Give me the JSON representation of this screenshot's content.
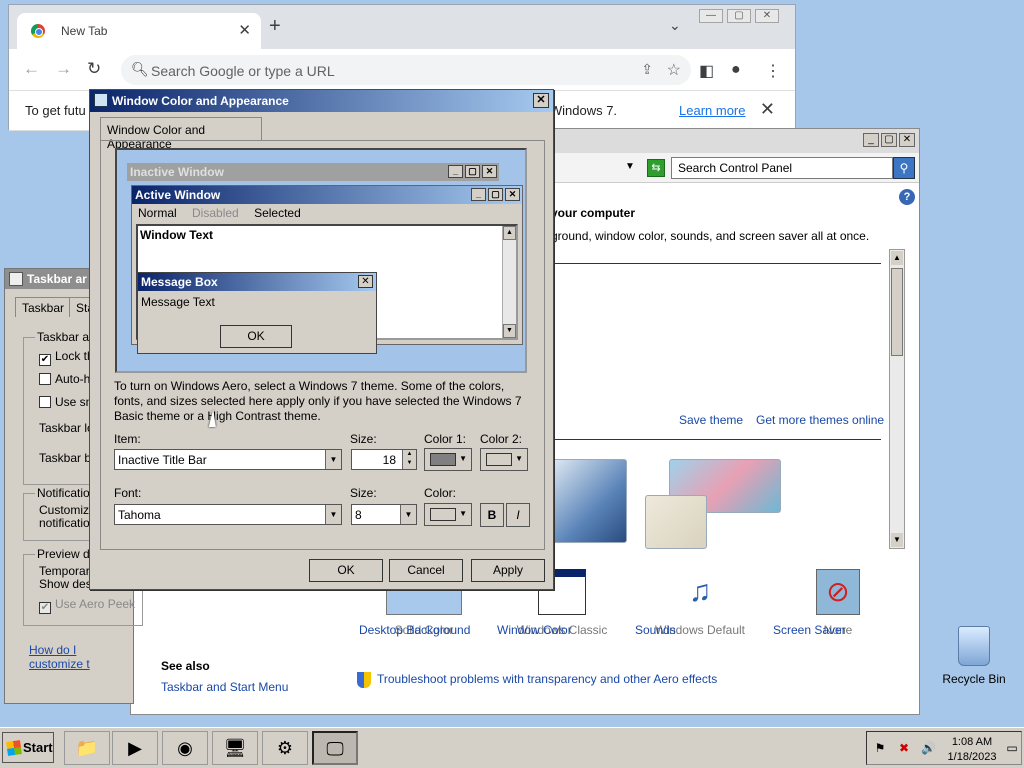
{
  "browser": {
    "tab_title": "New Tab",
    "omnibox_placeholder": "Search Google or type a URL",
    "infobar_message_start": "To get futu",
    "infobar_message_end": "g Windows 7.",
    "infobar_link": "Learn more"
  },
  "control_panel": {
    "search_placeholder": "Search Control Panel",
    "heading": "your computer",
    "subheading": "ground, window color, sounds, and screen saver all at once.",
    "save_theme": "Save theme",
    "more_themes": "Get more themes online",
    "items": [
      {
        "label": "Desktop Background",
        "sub": "Solid Color",
        "icon": "desktop-background-icon"
      },
      {
        "label": "Window Color",
        "sub": "Windows Classic",
        "icon": "window-color-icon"
      },
      {
        "label": "Sounds",
        "sub": "Windows Default",
        "icon": "sounds-icon"
      },
      {
        "label": "Screen Saver",
        "sub": "None",
        "icon": "screen-saver-icon"
      }
    ],
    "see_also": "See also",
    "see_also_link": "Taskbar and Start Menu",
    "troubleshoot": "Troubleshoot problems with transparency and other Aero effects"
  },
  "taskbar_props": {
    "title": "Taskbar ar",
    "tabs": [
      "Taskbar",
      "Sta"
    ],
    "group1": "Taskbar ap",
    "opt_lock": "Lock th",
    "opt_autohide": "Auto-h",
    "opt_small": "Use sm",
    "taskbar_loc": "Taskbar loc",
    "taskbar_btn": "Taskbar bu",
    "group2": "Notification",
    "notif_1": "Customize",
    "notif_2": "notification",
    "group3": "Preview de",
    "preview_1": "Temporaril",
    "preview_2": "Show desk",
    "use_aero_peek": "Use Aero Peek",
    "help_link": "How do I customize t"
  },
  "dialog": {
    "title": "Window Color and Appearance",
    "tab": "Window Color and Appearance",
    "preview": {
      "inactive_title": "Inactive Window",
      "active_title": "Active Window",
      "menu_normal": "Normal",
      "menu_disabled": "Disabled",
      "menu_selected": "Selected",
      "window_text": "Window Text",
      "msgbox_title": "Message Box",
      "msgbox_text": "Message Text",
      "msgbox_ok": "OK"
    },
    "description": "To turn on Windows Aero, select a Windows 7 theme.  Some of the colors, fonts, and sizes selected here apply only if you have selected the Windows 7 Basic theme or a High Contrast theme.",
    "item_label": "Item:",
    "item_value": "Inactive Title Bar",
    "size_label": "Size:",
    "size_value": "18",
    "color1_label": "Color 1:",
    "color2_label": "Color 2:",
    "color1_value": "#808080",
    "color2_value": "#d4d0c8",
    "font_label": "Font:",
    "font_value": "Tahoma",
    "font_size_label": "Size:",
    "font_size_value": "8",
    "font_color_label": "Color:",
    "font_color_value": "#d4d0c8",
    "bold": "B",
    "italic": "I",
    "ok": "OK",
    "cancel": "Cancel",
    "apply": "Apply"
  },
  "desktop": {
    "recycle_bin": "Recycle Bin"
  },
  "taskbar": {
    "start": "Start",
    "time": "1:08 AM",
    "date": "1/18/2023"
  }
}
